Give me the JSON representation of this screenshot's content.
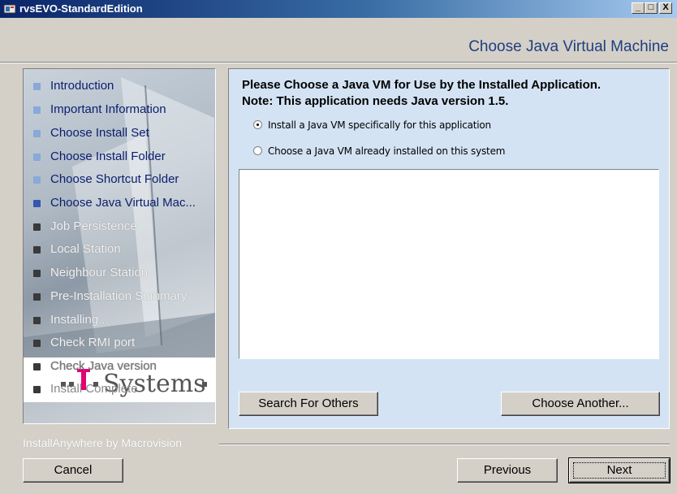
{
  "window": {
    "title": "rvsEVO-StandardEdition",
    "minimize_label": "_",
    "maximize_label": "□",
    "close_label": "X"
  },
  "header": {
    "page_heading": "Choose Java Virtual Machine"
  },
  "sidebar": {
    "steps": [
      {
        "label": "Introduction",
        "state": "done"
      },
      {
        "label": "Important Information",
        "state": "done"
      },
      {
        "label": "Choose Install Set",
        "state": "done"
      },
      {
        "label": "Choose Install Folder",
        "state": "done"
      },
      {
        "label": "Choose Shortcut Folder",
        "state": "done"
      },
      {
        "label": "Choose Java Virtual Mac...",
        "state": "current"
      },
      {
        "label": "Job Persistence",
        "state": "todo"
      },
      {
        "label": "Local Station",
        "state": "todo"
      },
      {
        "label": "Neighbour Station",
        "state": "todo"
      },
      {
        "label": "Pre-Installation Summary",
        "state": "todo"
      },
      {
        "label": "Installing...",
        "state": "todo"
      },
      {
        "label": "Check RMI port",
        "state": "todo"
      },
      {
        "label": "Check Java version",
        "state": "todo"
      },
      {
        "label": "Install Complete",
        "state": "todo"
      }
    ],
    "logo_text": "·T··Systems·"
  },
  "main": {
    "prompt_line1": "Please Choose a Java VM for Use by the Installed Application.",
    "prompt_line2": "Note: This application needs Java version 1.5.",
    "options": [
      {
        "label": "Install a Java VM specifically for this application",
        "selected": true
      },
      {
        "label": "Choose a Java VM already installed on this system",
        "selected": false
      }
    ],
    "search_button": "Search For Others",
    "choose_button": "Choose Another..."
  },
  "footer": {
    "brand": "InstallAnywhere by Macrovision",
    "cancel_button": "Cancel",
    "previous_button": "Previous",
    "next_button": "Next"
  },
  "colors": {
    "title_bar": "#0a246a",
    "heading": "#1e3f7f",
    "panel_bg": "#d4e3f4",
    "window_bg": "#d4d0c8"
  }
}
